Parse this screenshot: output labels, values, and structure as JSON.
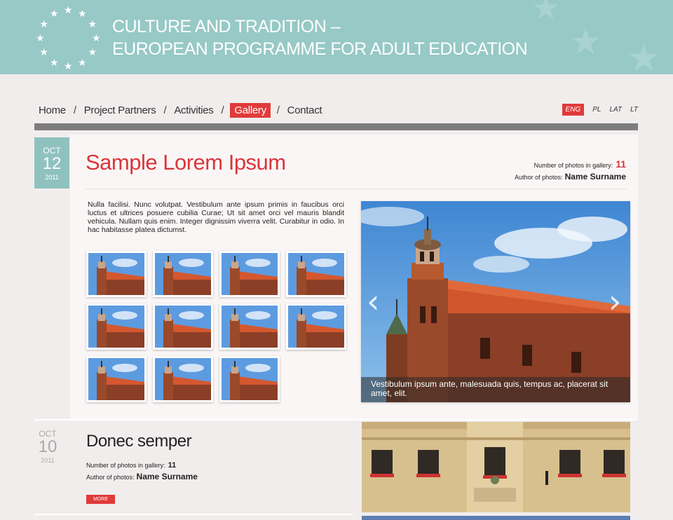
{
  "header": {
    "title_line1": "CULTURE AND TRADITION –",
    "title_line2": "EUROPEAN PROGRAMME FOR ADULT EDUCATION"
  },
  "nav": {
    "items": [
      "Home",
      "Project Partners",
      "Activities",
      "Gallery",
      "Contact"
    ],
    "active": "Gallery",
    "separator": "/"
  },
  "languages": {
    "items": [
      "ENG",
      "PL",
      "LAT",
      "LT"
    ],
    "active": "ENG"
  },
  "post1": {
    "date": {
      "month": "OCT",
      "day": "12",
      "year": "2011"
    },
    "title": "Sample Lorem Ipsum",
    "photos_label": "Number of photos in gallery:",
    "photos_count": "11",
    "author_label": "Author of photos:",
    "author_name": "Name Surname",
    "excerpt": "Nulla facilisi. Nunc volutpat. Vestibulum ante ipsum primis in faucibus orci luctus et ultrices posuere cubilia Curae; Ut sit amet orci vel mauris blandit vehicula. Nullam quis enim. Integer dignissim viverra velit. Curabitur in odio. In hac habitasse platea dictumst.",
    "thumbnail_count": 11,
    "slider": {
      "caption": "Vestibulum ipsum ante, malesuada quis, tempus ac, placerat sit amet, elit.",
      "prev_icon": "chevron-left-icon",
      "next_icon": "chevron-right-icon"
    }
  },
  "post2": {
    "date": {
      "month": "OCT",
      "day": "10",
      "year": "2011"
    },
    "title": "Donec semper",
    "photos_label": "Number of photos in gallery:",
    "photos_count": "11",
    "author_label": "Author of photos:",
    "author_name": "Name Surname",
    "more_label": "MORE"
  },
  "colors": {
    "header_bg": "#97c9c6",
    "accent_red": "#e03a3a",
    "date_box": "#8fc2bf",
    "page_bg": "#f1eded"
  }
}
